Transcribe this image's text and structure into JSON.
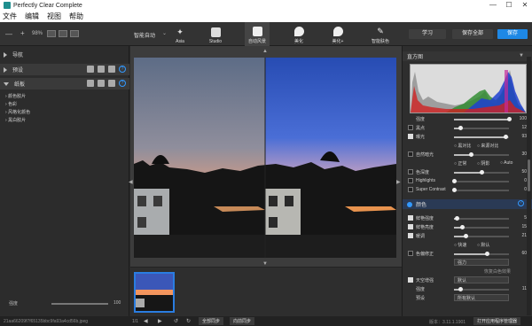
{
  "window": {
    "title": "Perfectly Clear Complete",
    "minimize": "—",
    "maximize": "☐",
    "close": "✕"
  },
  "menu": [
    "文件",
    "编辑",
    "视图",
    "帮助"
  ],
  "toolbar": {
    "zoom_out": "—",
    "zoom_in": "+",
    "zoom": "98%",
    "preset_label": "智能自动",
    "modes": [
      "Asia",
      "Studio",
      "自动风景",
      "美化",
      "美化+",
      "智能肤色"
    ],
    "learn": "学习",
    "save_all": "保存全部",
    "save": "保存"
  },
  "left": {
    "nav": "导航",
    "presets": "预设",
    "filters": "纸板",
    "tree": [
      "颜色胶片",
      "色彩",
      "风格化颜色",
      "黑白胶片"
    ],
    "strength_label": "强度",
    "strength_value": "100"
  },
  "right": {
    "histogram": "直方图",
    "rows": [
      {
        "label": "强度",
        "value": "100",
        "fill": 1.0,
        "checked": null
      },
      {
        "label": "黑点",
        "value": "12",
        "fill": 0.12,
        "checked": false
      },
      {
        "label": "曝光",
        "value": "93",
        "fill": 0.93,
        "checked": true
      },
      {
        "label": "",
        "value": "",
        "fill": null,
        "checked": null,
        "radios": [
          "黑对比",
          "来源对比"
        ]
      },
      {
        "label": "自然暗光",
        "value": "30",
        "fill": 0.3,
        "checked": false
      },
      {
        "label": "",
        "value": "",
        "fill": null,
        "checked": null,
        "radios": [
          "正常",
          "阴影",
          "Auto"
        ]
      },
      {
        "label": "色深度",
        "value": "50",
        "fill": 0.5,
        "checked": false
      },
      {
        "label": "Highlights",
        "value": "0",
        "fill": 0.0,
        "checked": false
      },
      {
        "label": "Super Contrast",
        "value": "0",
        "fill": 0.0,
        "checked": false
      }
    ],
    "color_section": "颜色",
    "color_rows": [
      {
        "label": "鲜艳强度",
        "value": "5",
        "fill": 0.05,
        "checked": true
      },
      {
        "label": "鲜艳亮度",
        "value": "15",
        "fill": 0.15,
        "checked": true
      },
      {
        "label": "暖调",
        "value": "21",
        "fill": 0.21,
        "checked": true
      },
      {
        "label": "",
        "value": "",
        "fill": null,
        "checked": null,
        "radios": [
          "快速",
          "默认"
        ]
      },
      {
        "label": "色偏修正",
        "value": "60",
        "fill": 0.6,
        "checked": false
      },
      {
        "label": "",
        "value": "",
        "fill": null,
        "checked": null,
        "select": "强力"
      },
      {
        "label": "",
        "value": "",
        "fill": null,
        "checked": null,
        "note": "恢复白色效果"
      },
      {
        "label": "天空增强",
        "value": "",
        "fill": null,
        "checked": true,
        "select": "默认"
      },
      {
        "label": "强度",
        "value": "11",
        "fill": 0.11,
        "checked": null
      },
      {
        "label": "预设",
        "value": "",
        "fill": null,
        "checked": null,
        "select": "所有默认"
      }
    ]
  },
  "status": {
    "file": "21aa66209f7f65135bbc9fa93a4cd56b.jpeg",
    "page": "1/1",
    "sync_all": "全部同步",
    "sync_forward": "向前同步",
    "version": "版本：3.11.1.1901",
    "open_manager": "打开应用程序管理器"
  },
  "colors": {
    "accent": "#1e88e5",
    "help": "#3399ff"
  }
}
